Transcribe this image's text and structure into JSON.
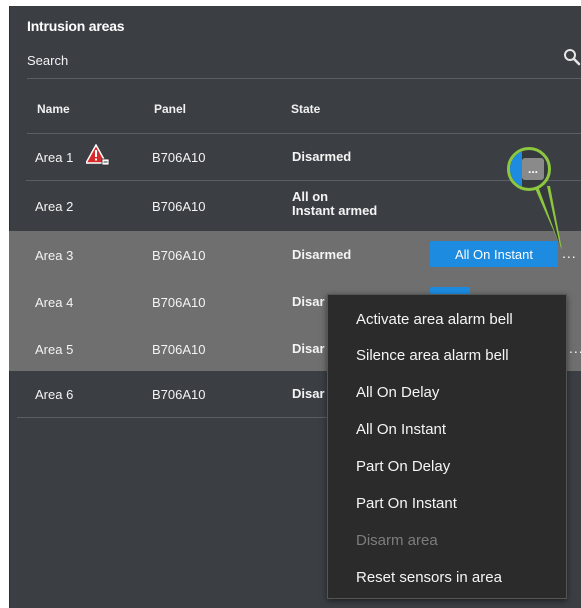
{
  "panel": {
    "title": "Intrusion areas",
    "search": {
      "label": "Search",
      "icon": "search-icon"
    }
  },
  "table": {
    "headers": [
      "Name",
      "Panel",
      "State"
    ],
    "rows": [
      {
        "name": "Area 1",
        "panel": "B706A10",
        "state": "Disarmed",
        "warning": true,
        "warning_icon": "alert-triangle-icon"
      },
      {
        "name": "Area 2",
        "panel": "B706A10",
        "state_line1": "All on",
        "state_line2": "Instant armed"
      },
      {
        "name": "Area 3",
        "panel": "B706A10",
        "state": "Disarmed",
        "action": "All On Instant",
        "more": "..."
      },
      {
        "name": "Area 4",
        "panel": "B706A10",
        "state": "Disar",
        "more": "..."
      },
      {
        "name": "Area 5",
        "panel": "B706A10",
        "state": "Disar",
        "more": "..."
      },
      {
        "name": "Area 6",
        "panel": "B706A10",
        "state": "Disar"
      }
    ]
  },
  "callout": {
    "dots": "...",
    "accent": "#8dc63f"
  },
  "context_menu": {
    "items": [
      {
        "label": "Activate area alarm bell",
        "enabled": true
      },
      {
        "label": "Silence area alarm bell",
        "enabled": true
      },
      {
        "label": "All On Delay",
        "enabled": true
      },
      {
        "label": "All On Instant",
        "enabled": true
      },
      {
        "label": "Part On Delay",
        "enabled": true
      },
      {
        "label": "Part On Instant",
        "enabled": true
      },
      {
        "label": "Disarm area",
        "enabled": false
      },
      {
        "label": "Reset sensors in area",
        "enabled": true
      }
    ]
  },
  "colors": {
    "panel_bg": "#3b3f44",
    "dim_row": "#6f6f6f",
    "action_blue": "#1c8be0",
    "menu_bg": "#2b2b2b",
    "warning_red": "#d62b2b"
  }
}
